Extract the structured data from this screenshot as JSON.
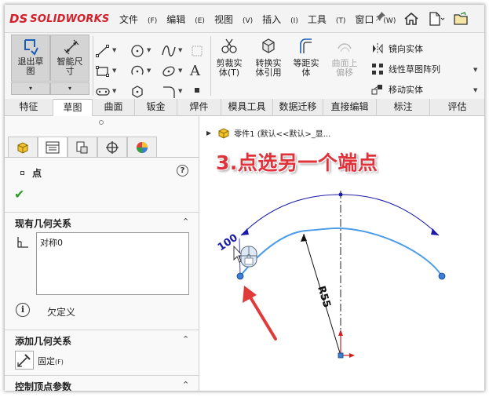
{
  "app": {
    "brand_prefix": "DS",
    "brand_name": "SOLIDWORKS"
  },
  "menubar": {
    "items": [
      {
        "label": "文件",
        "key": "(F)"
      },
      {
        "label": "编辑",
        "key": "(E)"
      },
      {
        "label": "视图",
        "key": "(V)"
      },
      {
        "label": "插入",
        "key": "(I)"
      },
      {
        "label": "工具",
        "key": "(T)"
      },
      {
        "label": "窗口",
        "key": "(W)"
      }
    ]
  },
  "ribbon": {
    "exit_sketch": "退出草\n图",
    "smart_dimension": "智能尺\n寸",
    "trim_entities": "剪裁实\n体(T)",
    "convert_entities": "转换实\n体引用",
    "offset_entities": "等距实\n体",
    "offset_on_surface": "曲面上\n偏移",
    "mirror_entities": "镜向实体",
    "linear_pattern": "线性草图阵列",
    "move_entities": "移动实体"
  },
  "tabs": [
    "特征",
    "草图",
    "曲面",
    "钣金",
    "焊件",
    "模具工具",
    "数据迁移",
    "直接编辑",
    "标注",
    "评估"
  ],
  "active_tab": "草图",
  "property_manager": {
    "title": "点",
    "existing_relations_header": "现有几何关系",
    "relations": [
      "对称0"
    ],
    "status": "欠定义",
    "add_relations_header": "添加几何关系",
    "fix_label": "固定",
    "fix_key": "(F)",
    "control_vertex_header": "控制顶点参数"
  },
  "feature_tree": {
    "part_label": "零件1  (默认<<默认>_显..."
  },
  "annotation": {
    "text": "3.点选另一个端点"
  },
  "sketch": {
    "angle_dimension": "100",
    "radius_dimension": "R55"
  },
  "colors": {
    "annotation": "#e0323a",
    "dimension": "#1a1aa8",
    "arc": "#4a9be8",
    "point": "#3a7fd6"
  }
}
